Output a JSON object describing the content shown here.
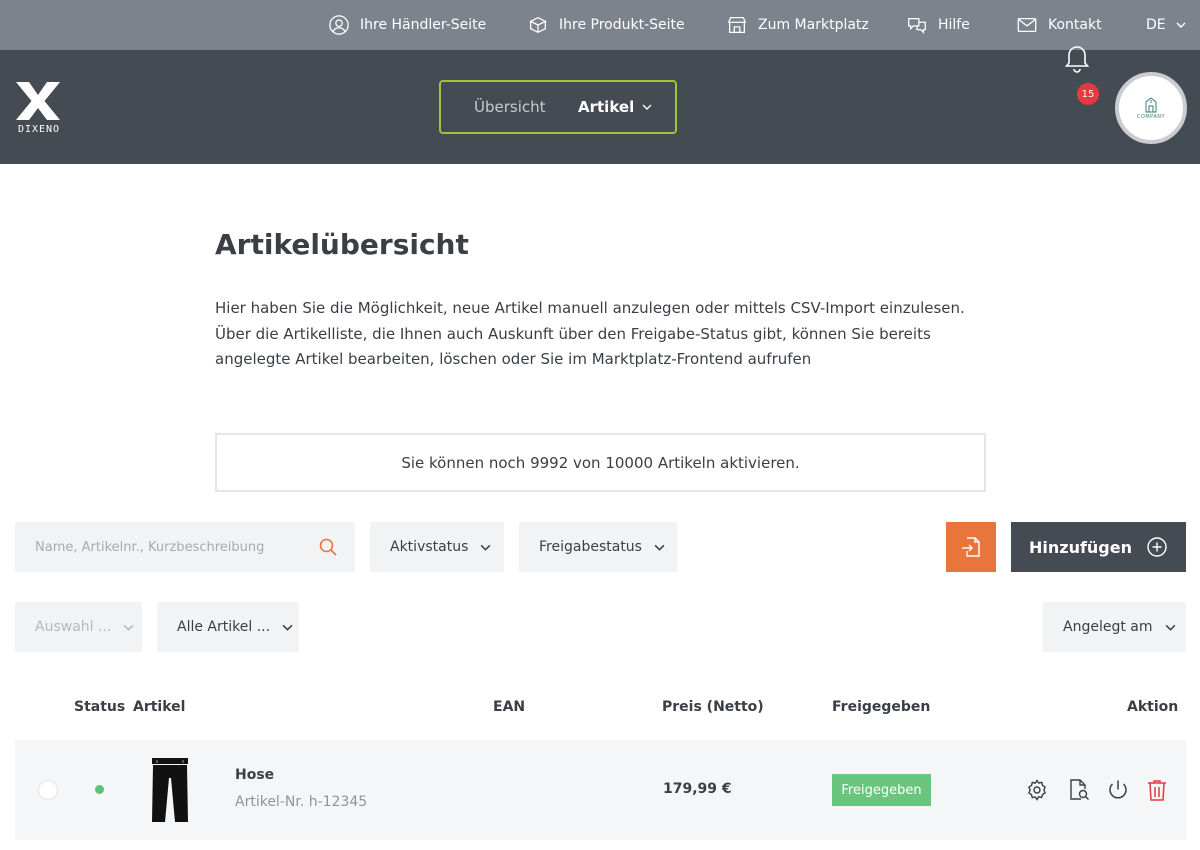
{
  "topbar": {
    "items": [
      {
        "label": "Ihre Händler-Seite",
        "icon": "user-circle-icon"
      },
      {
        "label": "Ihre Produkt-Seite",
        "icon": "box-icon"
      },
      {
        "label": "Zum Marktplatz",
        "icon": "store-icon"
      },
      {
        "label": "Hilfe",
        "icon": "chat-help-icon"
      },
      {
        "label": "Kontakt",
        "icon": "mail-icon"
      }
    ],
    "language": "DE"
  },
  "header": {
    "logo_text": "DIXENO",
    "nav": {
      "overview": "Übersicht",
      "articles": "Artikel"
    },
    "notifications": "15",
    "avatar_text": "COMPANY"
  },
  "main": {
    "title": "Artikelübersicht",
    "intro": "Hier haben Sie die Möglichkeit, neue Artikel manuell anzulegen oder mittels CSV-Import einzulesen. Über die Artikelliste, die Ihnen auch Auskunft über den Freigabe-Status gibt, können Sie bereits angelegte Artikel bearbeiten, löschen oder Sie im Marktplatz-Frontend aufrufen",
    "notice": "Sie können noch 9992 von 10000 Artikeln aktivieren."
  },
  "filters": {
    "search_placeholder": "Name, Artikelnr., Kurzbeschreibung",
    "active_status": "Aktivstatus",
    "approval_status": "Freigabestatus",
    "selection": "Auswahl ...",
    "all_articles": "Alle Artikel ...",
    "sort": "Angelegt am",
    "add_label": "Hinzufügen"
  },
  "table": {
    "headers": {
      "status": "Status",
      "article": "Artikel",
      "ean": "EAN",
      "price": "Preis (Netto)",
      "approved": "Freigegeben",
      "action": "Aktion"
    },
    "rows": [
      {
        "name": "Hose",
        "article_no": "Artikel-Nr. h-12345",
        "ean": "",
        "price": "179,99 €",
        "approved": "Freigegeben",
        "status": "active"
      }
    ]
  },
  "colors": {
    "accent_orange": "#e8763c",
    "header_dark": "#454b53",
    "topbar_gray": "#7d838c",
    "nav_border_green": "#9ec43a",
    "approved_green": "#6ac57f",
    "delete_red": "#e6393f",
    "badge_red": "#e6393f"
  }
}
